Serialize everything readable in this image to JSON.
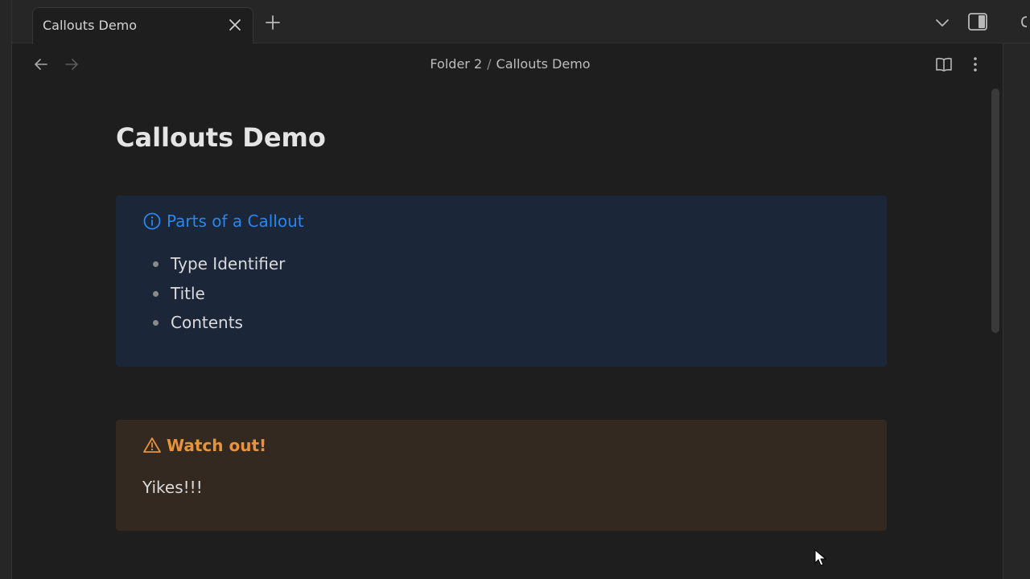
{
  "tabs": [
    {
      "title": "Callouts Demo",
      "active": true
    }
  ],
  "breadcrumb": {
    "folder": "Folder 2",
    "separator": "/",
    "note": "Callouts Demo"
  },
  "document": {
    "title": "Callouts Demo",
    "callouts": [
      {
        "type": "info",
        "icon": "info-icon",
        "title": "Parts of a Callout",
        "items": [
          "Type Identifier",
          "Title",
          "Contents"
        ]
      },
      {
        "type": "warning",
        "icon": "warning-icon",
        "title": "Watch out!",
        "body": "Yikes!!!"
      }
    ]
  },
  "colors": {
    "background": "#1e1e1e",
    "info_accent": "#2b86ec",
    "info_bg": "#1b2638",
    "warning_accent": "#e6933b",
    "warning_bg": "#332920"
  }
}
